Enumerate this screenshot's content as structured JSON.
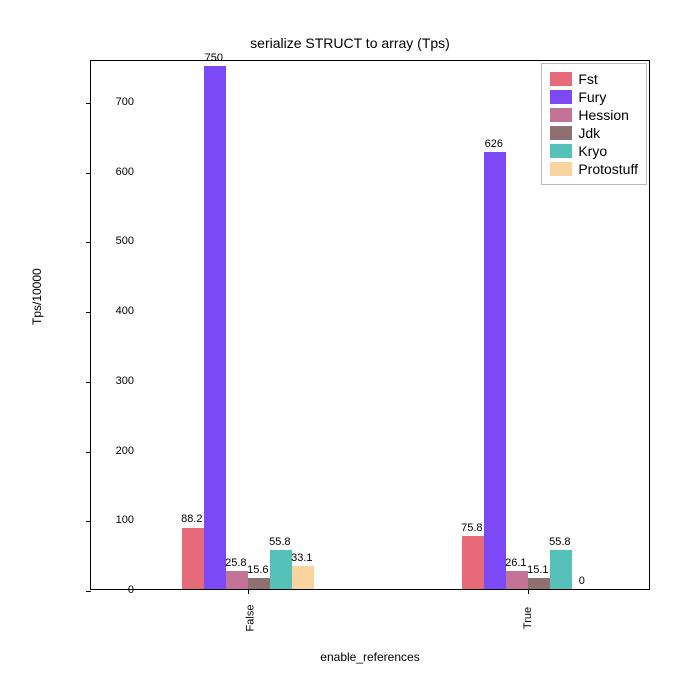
{
  "chart_data": {
    "type": "bar",
    "title": "serialize STRUCT to array (Tps)",
    "xlabel": "enable_references",
    "ylabel": "Tps/10000",
    "ylim": [
      0,
      760
    ],
    "yticks": [
      0,
      100,
      200,
      300,
      400,
      500,
      600,
      700
    ],
    "categories": [
      "False",
      "True"
    ],
    "series": [
      {
        "name": "Fst",
        "color": "#e66a79",
        "values": [
          88.2,
          75.8
        ],
        "labels": [
          "88.2",
          "75.8"
        ]
      },
      {
        "name": "Fury",
        "color": "#7b4af6",
        "values": [
          750,
          626
        ],
        "labels": [
          "750",
          "626"
        ]
      },
      {
        "name": "Hession",
        "color": "#c27396",
        "values": [
          25.8,
          26.1
        ],
        "labels": [
          "25.8",
          "26.1"
        ]
      },
      {
        "name": "Jdk",
        "color": "#8e7072",
        "values": [
          15.6,
          15.1
        ],
        "labels": [
          "15.6",
          "15.1"
        ]
      },
      {
        "name": "Kryo",
        "color": "#55c1b9",
        "values": [
          55.8,
          55.8
        ],
        "labels": [
          "55.8",
          "55.8"
        ]
      },
      {
        "name": "Protostuff",
        "color": "#fad49e",
        "values": [
          33.1,
          0
        ],
        "labels": [
          "33.1",
          "0"
        ]
      }
    ]
  }
}
